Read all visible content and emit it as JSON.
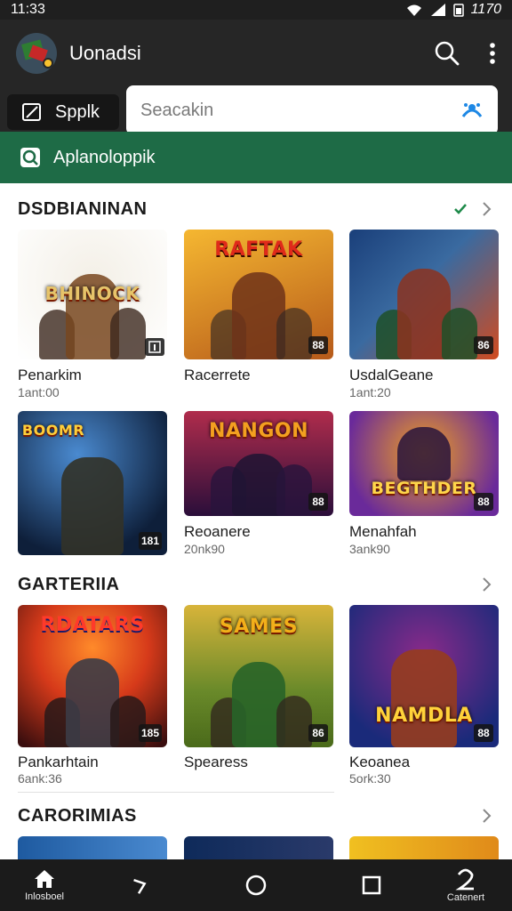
{
  "status_bar": {
    "time": "11:33",
    "battery_text": "1170"
  },
  "app_bar": {
    "title": "Uonadsi",
    "icons": [
      "search-icon",
      "more-vert-icon"
    ]
  },
  "tab_pill": {
    "label": "Spplk"
  },
  "search": {
    "placeholder": "Seacakin"
  },
  "banner": {
    "label": "Aplanoloppik"
  },
  "sections": [
    {
      "title": "DSDBIANINAN",
      "rows": [
        [
          {
            "name": "Penarkim",
            "sub": "1ant:00",
            "badge": "",
            "logo": "BHINOCK",
            "palette": [
              "#ffffff",
              "#f3efe6"
            ]
          },
          {
            "name": "Racerrete",
            "sub": "",
            "badge": "88",
            "logo": "RAFTAK",
            "palette": [
              "#f5b731",
              "#b65a1a"
            ]
          },
          {
            "name": "UsdalGeane",
            "sub": "1ant:20",
            "badge": "86",
            "logo": "",
            "palette": [
              "#1a3f7a",
              "#d14a1e"
            ]
          }
        ],
        [
          {
            "name": "",
            "sub": "",
            "badge": "181",
            "logo": "BOOMR",
            "palette": [
              "#1d4a86",
              "#0e1f3a"
            ]
          },
          {
            "name": "Reoanere",
            "sub": "20nk90",
            "badge": "88",
            "logo": "NANGON",
            "palette": [
              "#b02c4c",
              "#2a0e3a"
            ]
          },
          {
            "name": "Menahfah",
            "sub": "3ank90",
            "badge": "88",
            "logo": "BEGTHDER",
            "palette": [
              "#6a2a9a",
              "#f0a020"
            ]
          }
        ]
      ]
    },
    {
      "title": "GARTERIIA",
      "rows": [
        [
          {
            "name": "Pankarhtain",
            "sub": "6ank:36",
            "badge": "185",
            "logo": "RDATARS",
            "palette": [
              "#d63a1a",
              "#3a0e0e"
            ]
          },
          {
            "name": "Spearess",
            "sub": "",
            "badge": "86",
            "logo": "SAMES",
            "palette": [
              "#d8b43a",
              "#4a6a1a"
            ]
          },
          {
            "name": "Keoanea",
            "sub": "5ork:30",
            "badge": "88",
            "logo": "NAMDLA",
            "palette": [
              "#1a2a7a",
              "#8a2a8a"
            ]
          }
        ]
      ]
    },
    {
      "title": "CARORIMIAS"
    }
  ],
  "bottom_nav": {
    "home_label": "Inlosboel",
    "profile_label": "Catenert"
  }
}
